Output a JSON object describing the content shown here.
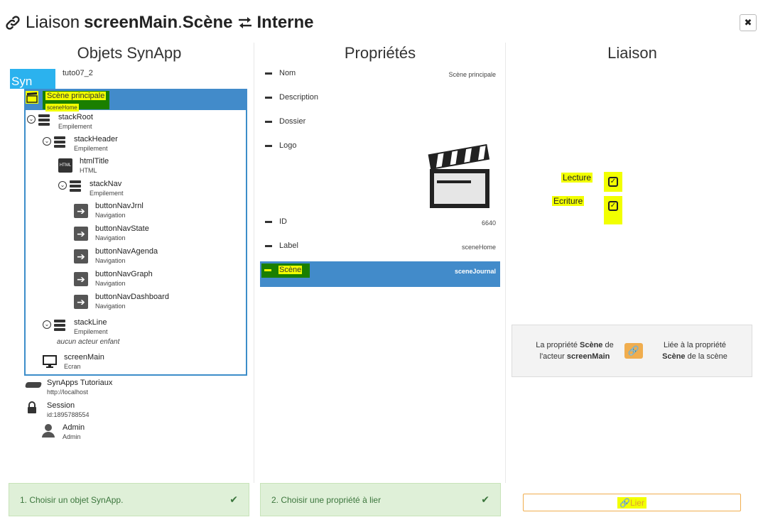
{
  "header": {
    "prefix": "Liaison",
    "actor": "screenMain",
    "sep": ".",
    "property": "Scène",
    "target": "Interne",
    "close_label": "✖"
  },
  "columns": {
    "objects": "Objets SynApp",
    "properties": "Propriétés",
    "liaison": "Liaison"
  },
  "tree": {
    "logo_text": "Syn",
    "root_label": "tuto07_2",
    "selected": {
      "label": "Scène principale",
      "sub": "sceneHome"
    },
    "nodes": [
      {
        "label": "stackRoot",
        "sub": "Empilement"
      },
      {
        "label": "stackHeader",
        "sub": "Empilement"
      },
      {
        "label": "htmlTitle",
        "sub": "HTML"
      },
      {
        "label": "stackNav",
        "sub": "Empilement"
      },
      {
        "label": "buttonNavJrnl",
        "sub": "Navigation"
      },
      {
        "label": "buttonNavState",
        "sub": "Navigation"
      },
      {
        "label": "buttonNavAgenda",
        "sub": "Navigation"
      },
      {
        "label": "buttonNavGraph",
        "sub": "Navigation"
      },
      {
        "label": "buttonNavDashboard",
        "sub": "Navigation"
      },
      {
        "label": "stackLine",
        "sub": "Empilement"
      },
      {
        "label": "screenMain",
        "sub": "Ecran"
      }
    ],
    "empty_child": "aucun acteur enfant",
    "html_icon_text": "HTML",
    "extras": [
      {
        "label": "SynApps Tutoriaux",
        "sub": "http://localhost"
      },
      {
        "label": "Session",
        "sub": "id:1895788554"
      },
      {
        "label": "Admin",
        "sub": "Admin"
      }
    ]
  },
  "props": [
    {
      "name": "Nom",
      "value": "Scène principale"
    },
    {
      "name": "Description",
      "value": ""
    },
    {
      "name": "Dossier",
      "value": ""
    },
    {
      "name": "Logo",
      "value": ""
    },
    {
      "name": "ID",
      "value": "6640"
    },
    {
      "name": "Label",
      "value": "sceneHome"
    },
    {
      "name": "Scène",
      "value": "sceneJournal"
    }
  ],
  "liaison": {
    "read_label": "Lecture",
    "write_label": "Ecriture",
    "info_left_1": "La propriété",
    "info_left_bold": "Scène",
    "info_left_2": "de",
    "info_left_3": "l'acteur",
    "info_left_actor": "screenMain",
    "info_right_1": "Liée à la propriété",
    "info_right_bold": "Scène",
    "info_right_2": "de la scène"
  },
  "steps": {
    "step1": "1. Choisir un objet SynApp.",
    "step2": "2. Choisir une propriété à lier",
    "lier_label": "Lier"
  }
}
